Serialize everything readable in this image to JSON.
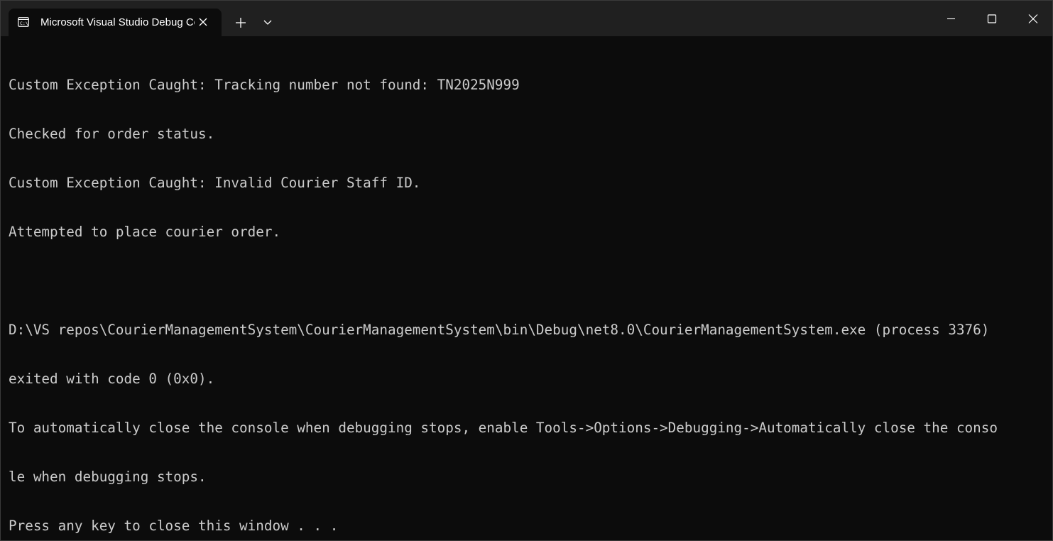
{
  "window": {
    "tab_title": "Microsoft Visual Studio Debug Console",
    "tab_icon": "console-app-icon",
    "tab_close_icon": "close-icon",
    "new_tab_icon": "plus-icon",
    "dropdown_icon": "chevron-down-icon",
    "minimize_icon": "minimize-icon",
    "maximize_icon": "maximize-icon",
    "close_icon": "close-icon"
  },
  "console": {
    "lines": [
      "Custom Exception Caught: Tracking number not found: TN2025N999",
      "Checked for order status.",
      "Custom Exception Caught: Invalid Courier Staff ID.",
      "Attempted to place courier order.",
      "",
      "D:\\VS repos\\CourierManagementSystem\\CourierManagementSystem\\bin\\Debug\\net8.0\\CourierManagementSystem.exe (process 3376)",
      "exited with code 0 (0x0).",
      "To automatically close the console when debugging stops, enable Tools->Options->Debugging->Automatically close the conso",
      "le when debugging stops.",
      "Press any key to close this window . . ."
    ]
  },
  "colors": {
    "background": "#0c0c0c",
    "titlebar": "#202020",
    "text": "#cccccc"
  }
}
